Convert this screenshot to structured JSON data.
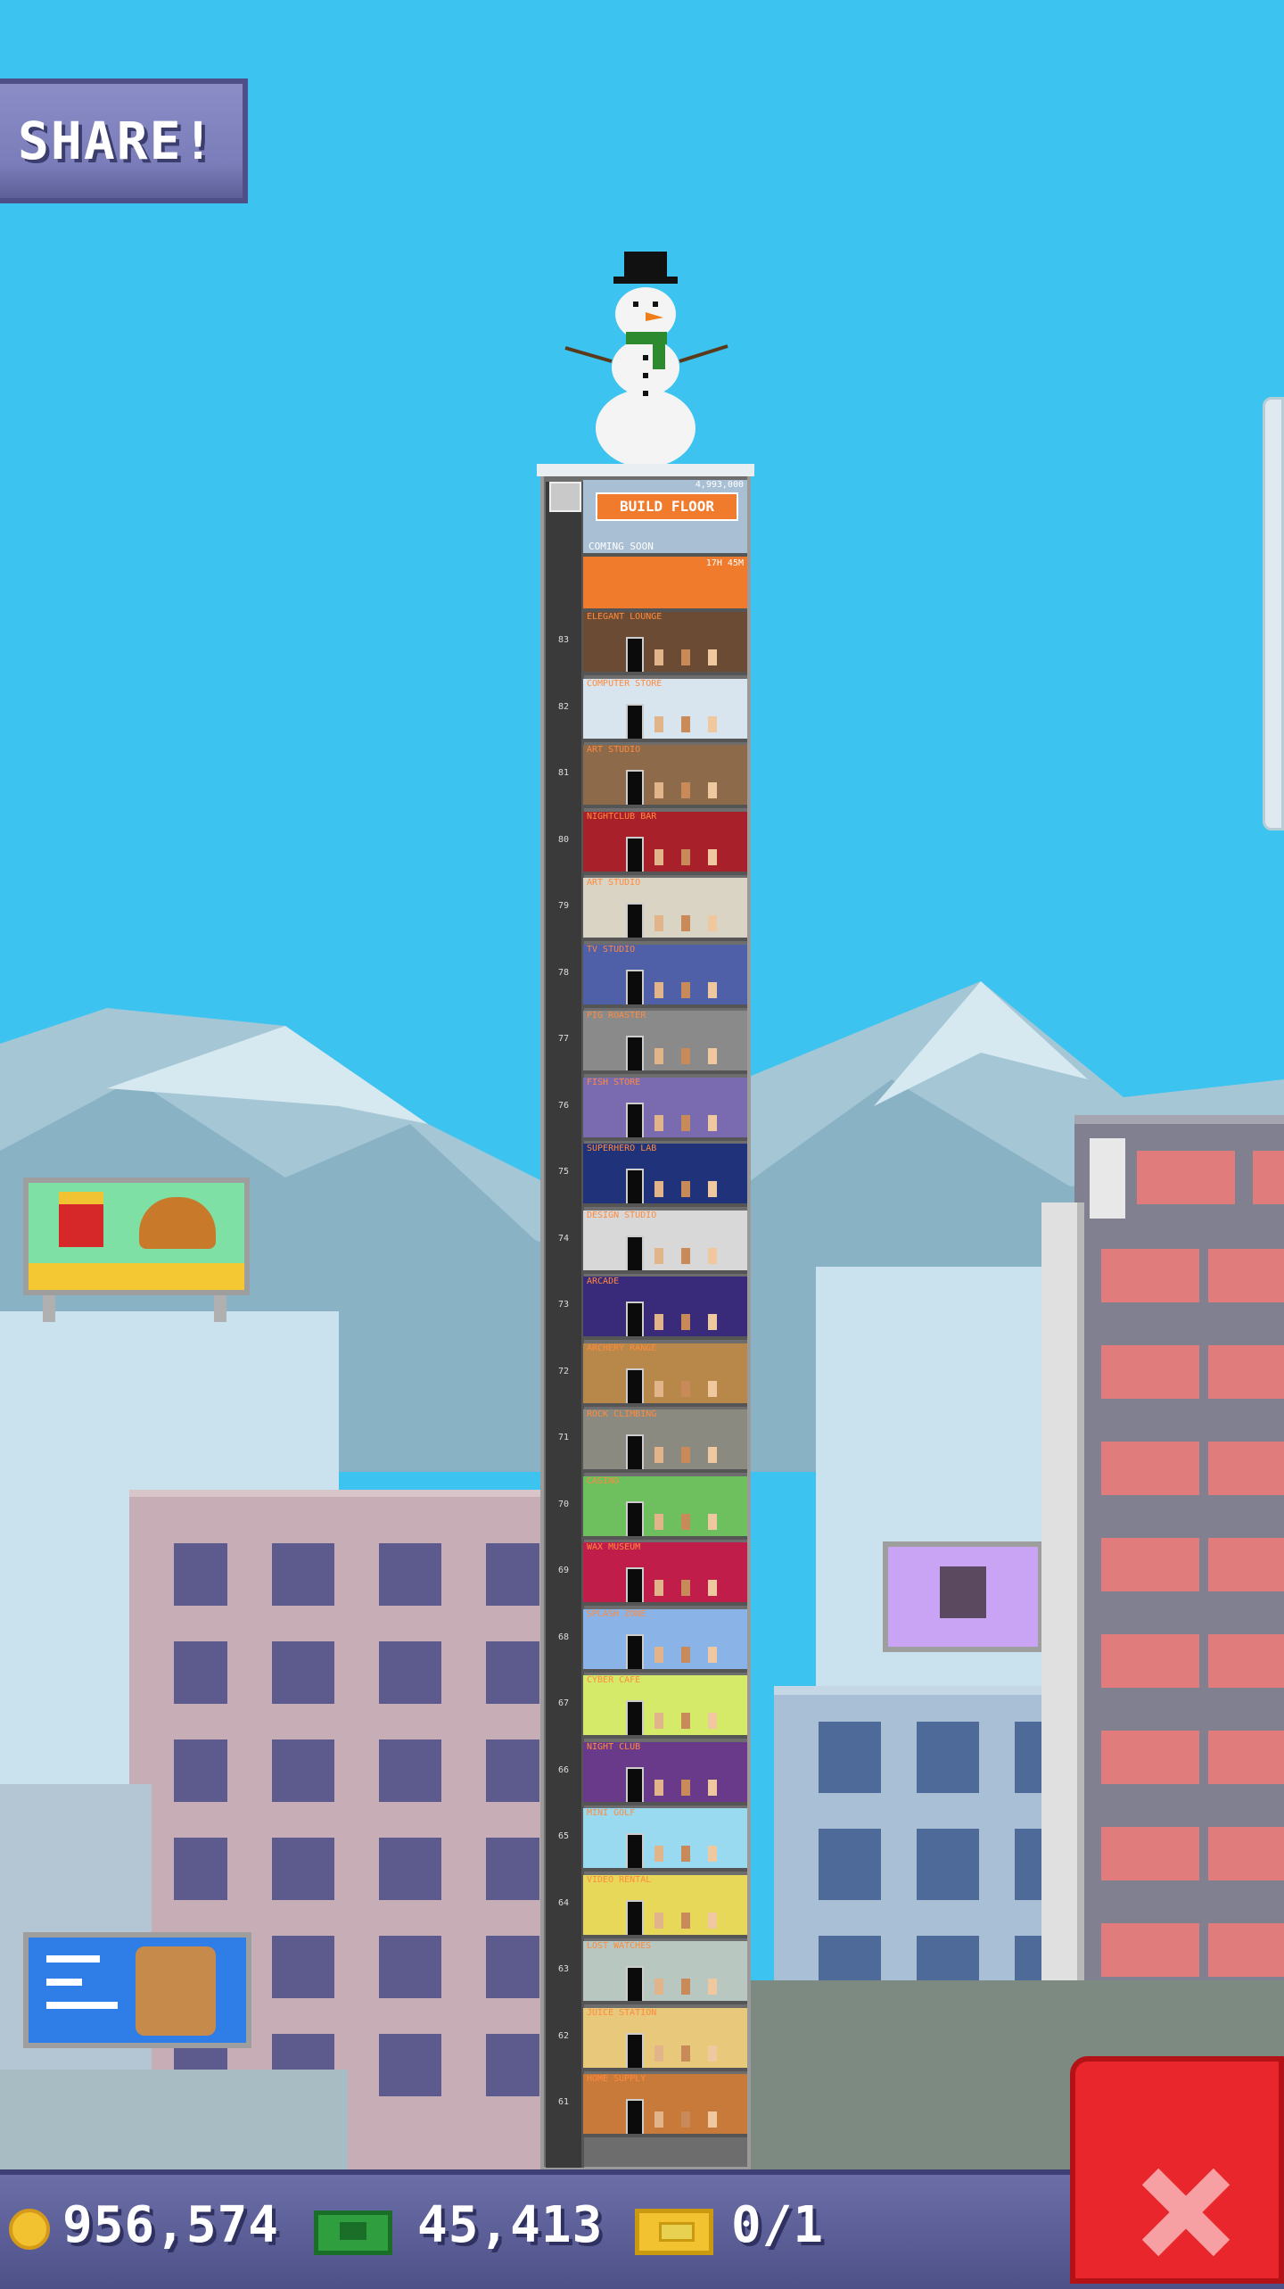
{
  "share": {
    "label": "SHARE!"
  },
  "tower": {
    "build_floor_label": "BUILD FLOOR",
    "build_floor_cost": "4,993,000",
    "coming_soon_label": "COMING SOON",
    "coming_soon_timer": "17H 45M",
    "floors": [
      {
        "name": "ELEGANT LOUNGE",
        "num": "83",
        "color": "#6b4b33"
      },
      {
        "name": "COMPUTER STORE",
        "num": "82",
        "color": "#d8e5ef"
      },
      {
        "name": "ART STUDIO",
        "num": "81",
        "color": "#8c6a4a"
      },
      {
        "name": "NIGHTCLUB BAR",
        "num": "80",
        "color": "#a8202a"
      },
      {
        "name": "ART STUDIO",
        "num": "79",
        "color": "#d9d4c4"
      },
      {
        "name": "TV STUDIO",
        "num": "78",
        "color": "#4f5fa8"
      },
      {
        "name": "PIG ROASTER",
        "num": "77",
        "color": "#8a8a8a"
      },
      {
        "name": "FISH STORE",
        "num": "76",
        "color": "#7a6ab0"
      },
      {
        "name": "SUPERHERO LAB",
        "num": "75",
        "color": "#20327a"
      },
      {
        "name": "DESIGN STUDIO",
        "num": "74",
        "color": "#d8d8d8"
      },
      {
        "name": "ARCADE",
        "num": "73",
        "color": "#3a2a7a"
      },
      {
        "name": "ARCHERY RANGE",
        "num": "72",
        "color": "#b8884a"
      },
      {
        "name": "ROCK CLIMBING",
        "num": "71",
        "color": "#8a8a80"
      },
      {
        "name": "CASINO",
        "num": "70",
        "color": "#6ec05e"
      },
      {
        "name": "WAX MUSEUM",
        "num": "69",
        "color": "#c01d4a"
      },
      {
        "name": "SPLASH ZONE",
        "num": "68",
        "color": "#8ab4e8"
      },
      {
        "name": "CYBER CAFE",
        "num": "67",
        "color": "#d6ea6a"
      },
      {
        "name": "NIGHT CLUB",
        "num": "66",
        "color": "#6a3a8a"
      },
      {
        "name": "MINI GOLF",
        "num": "65",
        "color": "#9adaf0"
      },
      {
        "name": "VIDEO RENTAL",
        "num": "64",
        "color": "#e8d85a"
      },
      {
        "name": "LOST WATCHES",
        "num": "63",
        "color": "#b8c8c0"
      },
      {
        "name": "JUICE STATION",
        "num": "62",
        "color": "#e8c87a"
      },
      {
        "name": "HOME SUPPLY",
        "num": "61",
        "color": "#c87a3a"
      }
    ]
  },
  "stats": {
    "coins": "956,574",
    "bux": "45,413",
    "tickets": "0/1"
  },
  "icons": {
    "coin": "coin-icon",
    "bux": "bux-icon",
    "ticket": "ticket-icon",
    "close": "close-icon"
  }
}
